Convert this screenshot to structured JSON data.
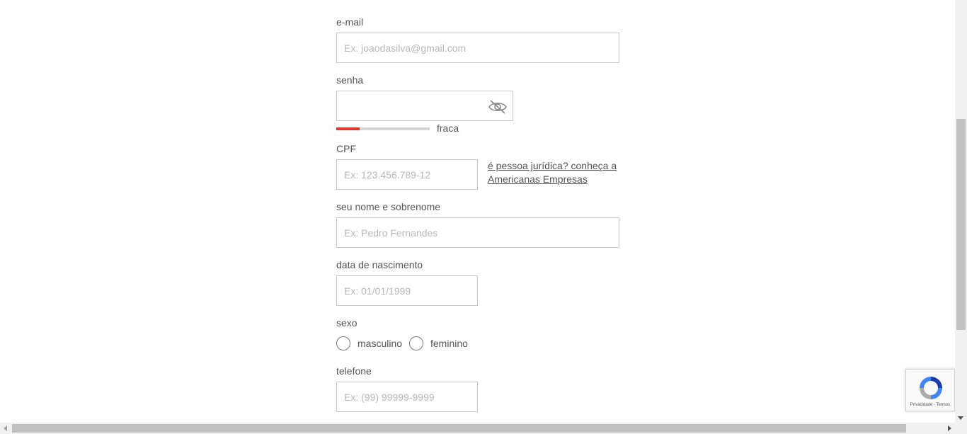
{
  "form": {
    "email": {
      "label": "e-mail",
      "placeholder": "Ex. joaodasilva@gmail.com"
    },
    "password": {
      "label": "senha",
      "placeholder": "",
      "toggle_icon": "eye-slash-icon"
    },
    "password_strength": {
      "label": "fraca",
      "level": 0.25,
      "color": "#e0362d"
    },
    "cpf": {
      "label": "CPF",
      "placeholder": "Ex: 123.456.789-12"
    },
    "pj_link": "é pessoa jurídica? conheça a Americanas Empresas",
    "name": {
      "label": "seu nome e sobrenome",
      "placeholder": "Ex: Pedro Fernandes"
    },
    "birthdate": {
      "label": "data de nascimento",
      "placeholder": "Ex: 01/01/1999"
    },
    "sex": {
      "label": "sexo",
      "options": [
        "masculino",
        "feminino"
      ]
    },
    "phone": {
      "label": "telefone",
      "placeholder": "Ex: (99) 99999-9999"
    }
  },
  "recaptcha": {
    "links": "Privacidade - Termos",
    "icon": "recaptcha-logo-icon"
  }
}
